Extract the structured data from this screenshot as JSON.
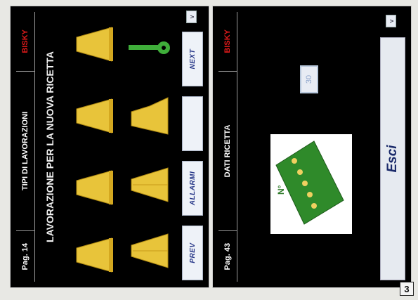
{
  "screen1": {
    "page_label": "Pag. 14",
    "title": "TIPI DI LAVORAZIONI",
    "brand": "BISKY",
    "heading": "LAVORAZIONE PER LA NUOVA RICETTA",
    "buttons": {
      "prev": "PREV",
      "allarmi": "ALLARMI",
      "blank": "",
      "next": "NEXT"
    },
    "scroll_glyph": "v",
    "nozzle_color": "#e8c43a",
    "tool_color": "#3fae3a"
  },
  "screen2": {
    "page_label": "Pag. 43",
    "title": "DATI RICETTA",
    "brand": "BISKY",
    "plate_label": "N°",
    "value": "30",
    "exit_label": "Esci",
    "scroll_glyph": "v",
    "plate_color": "#2f8a2a"
  },
  "figure_number": "3",
  "colors": {
    "accent_red": "#e01a1a",
    "button_text": "#2a3a8a"
  }
}
